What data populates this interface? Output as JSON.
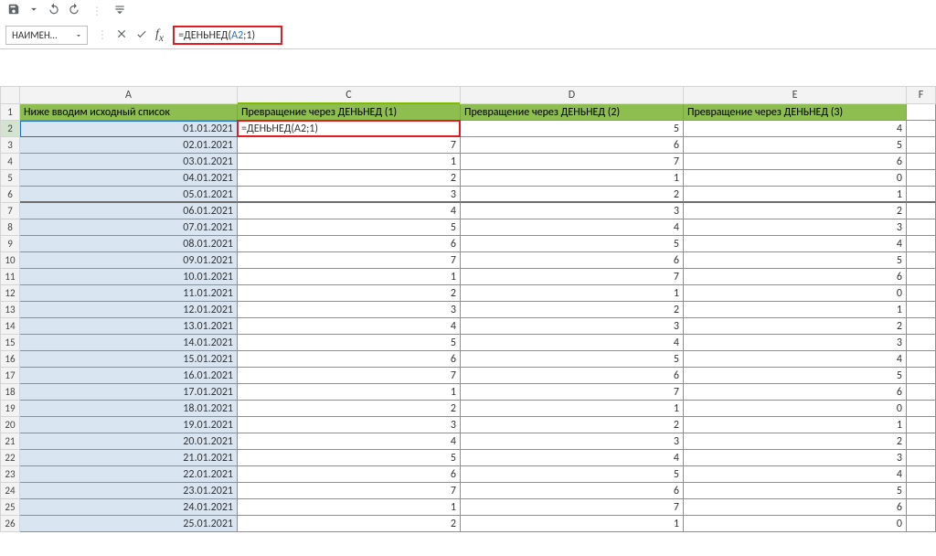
{
  "qat": {
    "save": "save-icon",
    "undo": "undo-icon",
    "redo": "redo-icon"
  },
  "nameBox": "НАИМЕН…",
  "formula": {
    "prefix": "=ДЕНЬНЕД(",
    "arg": "A2",
    "suffix": ";1)"
  },
  "columns": [
    "A",
    "C",
    "D",
    "E",
    "F"
  ],
  "headers": {
    "A": "Ниже вводим исходный список",
    "C": "Превращение через ДЕНЬНЕД (1)",
    "D": "Превращение через ДЕНЬНЕД (2)",
    "E": "Превращение через ДЕНЬНЕД (3)"
  },
  "editingCell": "=ДЕНЬНЕД(A2;1)",
  "rows": [
    {
      "n": 2,
      "a": "01.01.2021",
      "c": "",
      "d": "5",
      "e": "4"
    },
    {
      "n": 3,
      "a": "02.01.2021",
      "c": "7",
      "d": "6",
      "e": "5"
    },
    {
      "n": 4,
      "a": "03.01.2021",
      "c": "1",
      "d": "7",
      "e": "6"
    },
    {
      "n": 5,
      "a": "04.01.2021",
      "c": "2",
      "d": "1",
      "e": "0"
    },
    {
      "n": 6,
      "a": "05.01.2021",
      "c": "3",
      "d": "2",
      "e": "1"
    },
    {
      "n": 7,
      "a": "06.01.2021",
      "c": "4",
      "d": "3",
      "e": "2"
    },
    {
      "n": 8,
      "a": "07.01.2021",
      "c": "5",
      "d": "4",
      "e": "3"
    },
    {
      "n": 9,
      "a": "08.01.2021",
      "c": "6",
      "d": "5",
      "e": "4"
    },
    {
      "n": 10,
      "a": "09.01.2021",
      "c": "7",
      "d": "6",
      "e": "5"
    },
    {
      "n": 11,
      "a": "10.01.2021",
      "c": "1",
      "d": "7",
      "e": "6"
    },
    {
      "n": 12,
      "a": "11.01.2021",
      "c": "2",
      "d": "1",
      "e": "0"
    },
    {
      "n": 13,
      "a": "12.01.2021",
      "c": "3",
      "d": "2",
      "e": "1"
    },
    {
      "n": 14,
      "a": "13.01.2021",
      "c": "4",
      "d": "3",
      "e": "2"
    },
    {
      "n": 15,
      "a": "14.01.2021",
      "c": "5",
      "d": "4",
      "e": "3"
    },
    {
      "n": 16,
      "a": "15.01.2021",
      "c": "6",
      "d": "5",
      "e": "4"
    },
    {
      "n": 17,
      "a": "16.01.2021",
      "c": "7",
      "d": "6",
      "e": "5"
    },
    {
      "n": 18,
      "a": "17.01.2021",
      "c": "1",
      "d": "7",
      "e": "6"
    },
    {
      "n": 19,
      "a": "18.01.2021",
      "c": "2",
      "d": "1",
      "e": "0"
    },
    {
      "n": 20,
      "a": "19.01.2021",
      "c": "3",
      "d": "2",
      "e": "1"
    },
    {
      "n": 21,
      "a": "20.01.2021",
      "c": "4",
      "d": "3",
      "e": "2"
    },
    {
      "n": 22,
      "a": "21.01.2021",
      "c": "5",
      "d": "4",
      "e": "3"
    },
    {
      "n": 23,
      "a": "22.01.2021",
      "c": "6",
      "d": "5",
      "e": "4"
    },
    {
      "n": 24,
      "a": "23.01.2021",
      "c": "7",
      "d": "6",
      "e": "5"
    },
    {
      "n": 25,
      "a": "24.01.2021",
      "c": "1",
      "d": "7",
      "e": "6"
    },
    {
      "n": 26,
      "a": "25.01.2021",
      "c": "2",
      "d": "1",
      "e": "0"
    }
  ],
  "colors": {
    "headerFill": "#8dbe4f",
    "colAFill": "#d9e6f2",
    "highlight": "#e31b23",
    "argColor": "#1e6fd6"
  }
}
